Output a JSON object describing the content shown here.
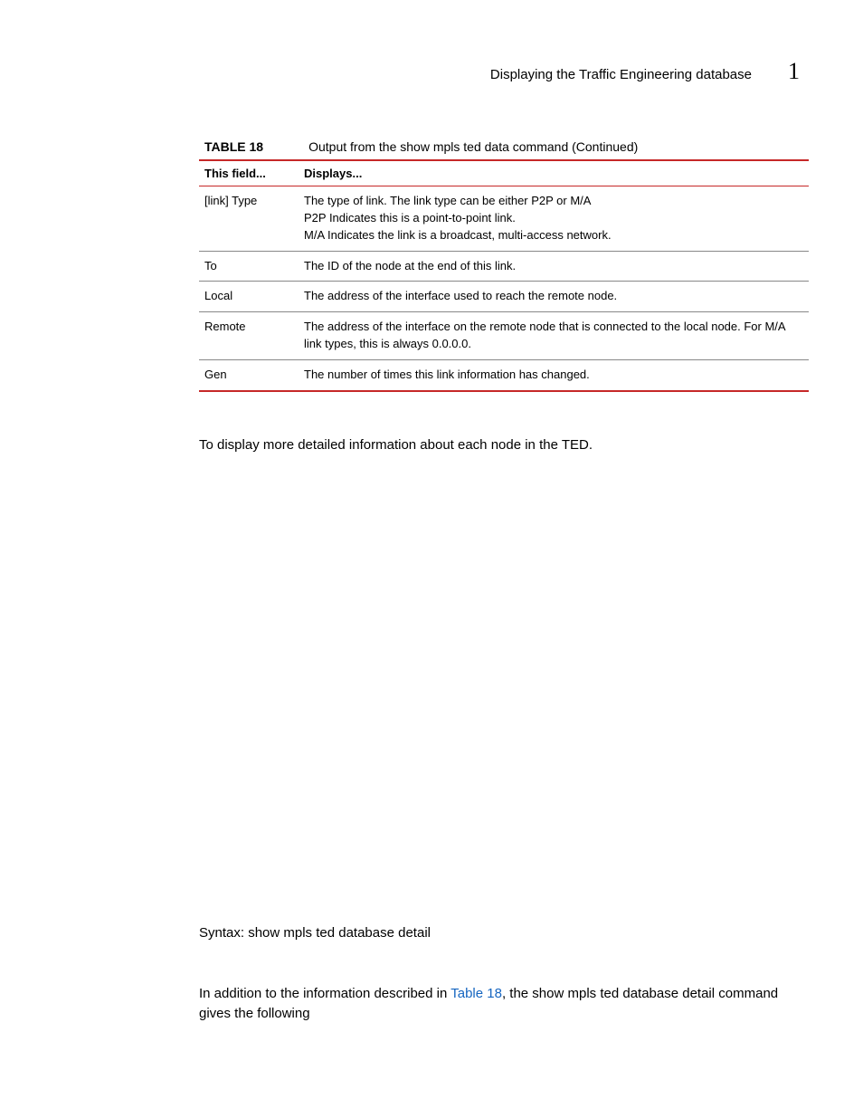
{
  "header": {
    "title": "Displaying the Traffic Engineering database",
    "chapter_number": "1"
  },
  "table": {
    "label": "TABLE 18",
    "caption": "Output from the show mpls ted data command  (Continued)",
    "col1": "This field...",
    "col2": "Displays...",
    "rows": [
      {
        "field": "[link] Type",
        "lines": [
          "The type of link.   The link type can be either P2P or M/A",
          "P2P Indicates this is a point-to-point link.",
          "M/A Indicates the link is a broadcast, multi-access network."
        ]
      },
      {
        "field": "To",
        "lines": [
          "The ID of the node at the end of this link."
        ]
      },
      {
        "field": "Local",
        "lines": [
          "The address of the interface used to reach the remote node."
        ]
      },
      {
        "field": "Remote",
        "lines": [
          "The address of the interface on the remote node that is connected to the local node. For M/A link types, this is always 0.0.0.0."
        ]
      },
      {
        "field": "Gen",
        "lines": [
          "The number of times this link information has changed."
        ]
      }
    ]
  },
  "paragraph1": "To display more detailed information about each node in the TED.",
  "syntax": "Syntax:  show mpls ted database detail",
  "addition": {
    "pre": "In addition to the information described in ",
    "link": "Table 18",
    "post": ", the show mpls ted database detail command gives the following"
  }
}
